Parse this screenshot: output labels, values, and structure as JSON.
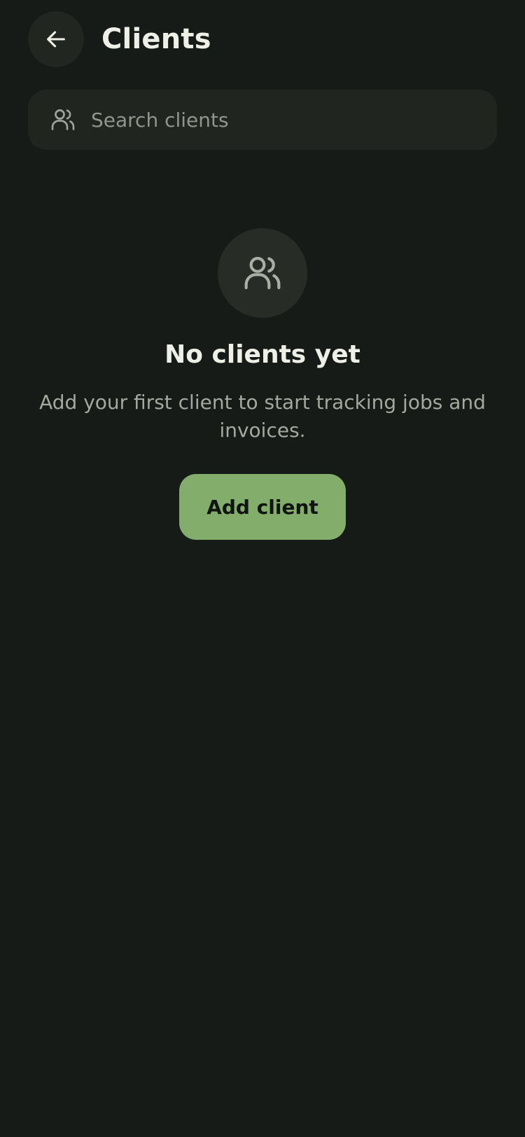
{
  "header": {
    "title": "Clients",
    "back_icon": "arrow-left-icon"
  },
  "search": {
    "placeholder": "Search clients",
    "value": "",
    "icon": "users-icon"
  },
  "empty_state": {
    "icon": "users-icon",
    "title": "No clients yet",
    "description": "Add your first client to start tracking jobs and invoices.",
    "button_label": "Add client"
  },
  "colors": {
    "background": "#161b17",
    "accent": "#83ad6a",
    "surface": "#202520"
  }
}
